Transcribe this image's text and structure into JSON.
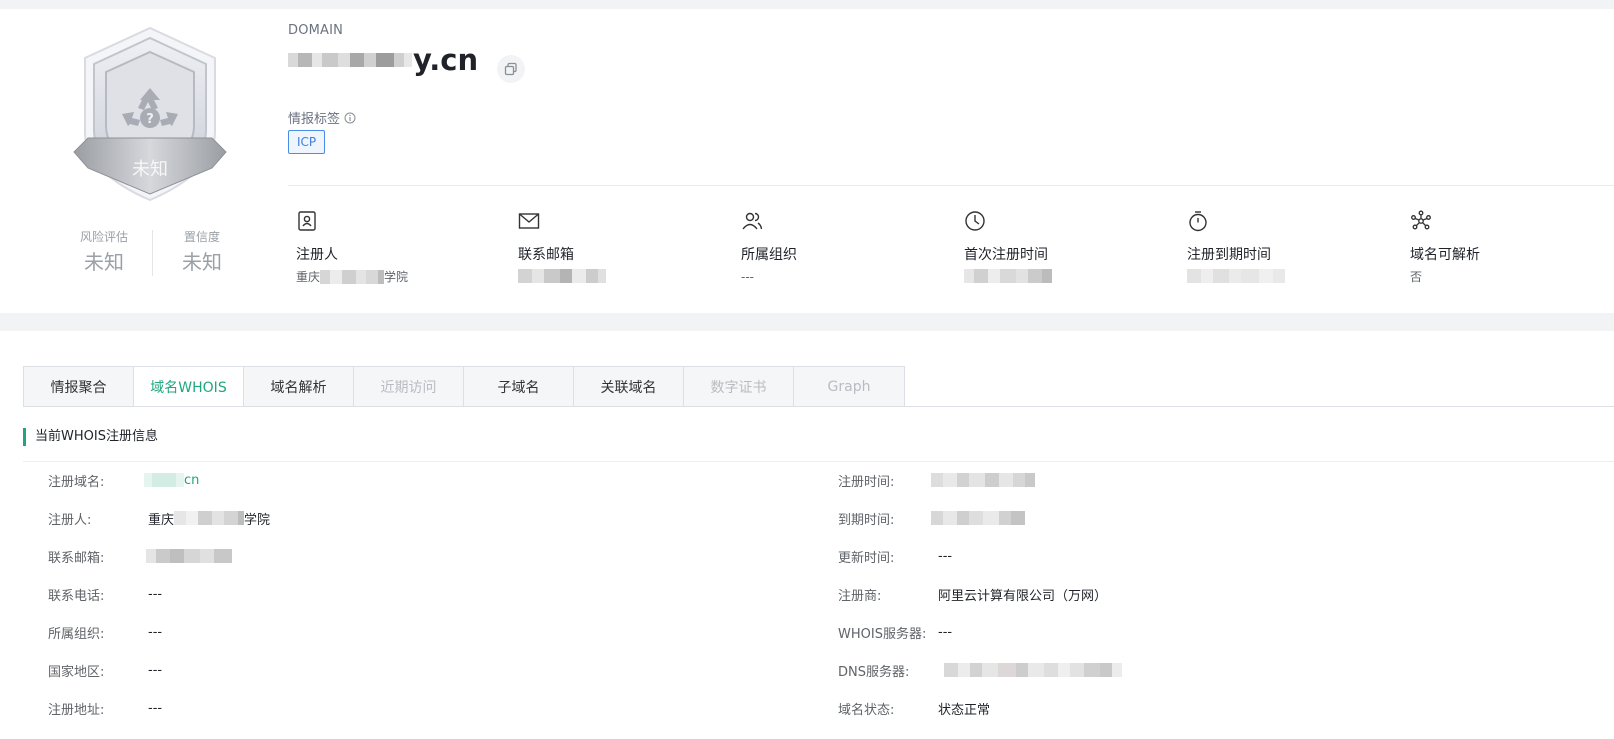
{
  "header": {
    "kicker": "DOMAIN",
    "domain_suffix": "y.cn",
    "badge_text": "未知",
    "risk_label": "风险评估",
    "risk_value": "未知",
    "confidence_label": "置信度",
    "confidence_value": "未知",
    "tags_title": "情报标签",
    "tags": [
      "ICP"
    ]
  },
  "meta": [
    {
      "icon": "contact-card-icon",
      "label": "注册人",
      "value_prefix": "重庆",
      "value_suffix": "学院"
    },
    {
      "icon": "mail-icon",
      "label": "联系邮箱",
      "value": ""
    },
    {
      "icon": "users-icon",
      "label": "所属组织",
      "value": "---"
    },
    {
      "icon": "clock-icon",
      "label": "首次注册时间",
      "value": ""
    },
    {
      "icon": "stopwatch-icon",
      "label": "注册到期时间",
      "value": ""
    },
    {
      "icon": "network-icon",
      "label": "域名可解析",
      "value": "否"
    }
  ],
  "tabs": [
    {
      "label": "情报聚合",
      "state": "normal"
    },
    {
      "label": "域名WHOIS",
      "state": "active"
    },
    {
      "label": "域名解析",
      "state": "normal"
    },
    {
      "label": "近期访问",
      "state": "disabled"
    },
    {
      "label": "子域名",
      "state": "normal"
    },
    {
      "label": "关联域名",
      "state": "normal"
    },
    {
      "label": "数字证书",
      "state": "disabled"
    },
    {
      "label": "Graph",
      "state": "disabled"
    }
  ],
  "whois": {
    "title": "当前WHOIS注册信息",
    "left": [
      {
        "key": "注册域名:",
        "value": "cn"
      },
      {
        "key": "注册人:",
        "value_prefix": "重庆",
        "value_suffix": "学院"
      },
      {
        "key": "联系邮箱:",
        "value": ""
      },
      {
        "key": "联系电话:",
        "value": "---"
      },
      {
        "key": "所属组织:",
        "value": "---"
      },
      {
        "key": "国家地区:",
        "value": "---"
      },
      {
        "key": "注册地址:",
        "value": "---"
      }
    ],
    "right": [
      {
        "key": "注册时间:",
        "value": ""
      },
      {
        "key": "到期时间:",
        "value": ""
      },
      {
        "key": "更新时间:",
        "value": "---"
      },
      {
        "key": "注册商:",
        "value": "阿里云计算有限公司（万网）"
      },
      {
        "key": "WHOIS服务器:",
        "value": "---"
      },
      {
        "key": "DNS服务器:",
        "value": ""
      },
      {
        "key": "域名状态:",
        "value": "状态正常"
      }
    ]
  },
  "colors": {
    "accent": "#20a67e",
    "tag_blue": "#3d7fe0",
    "page_bg": "#f2f3f5"
  }
}
